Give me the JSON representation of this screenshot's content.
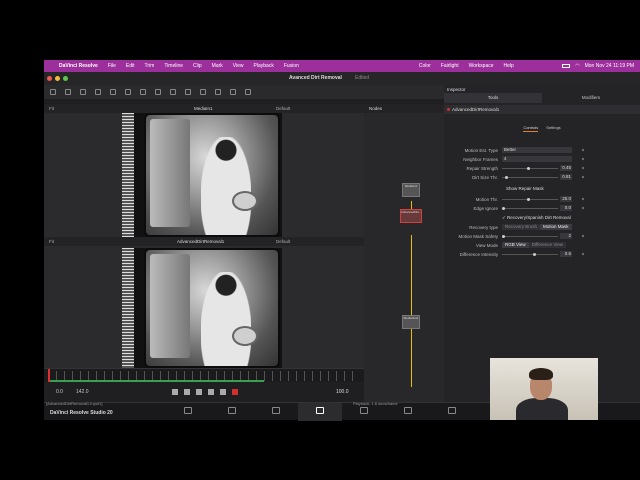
{
  "menubar": {
    "app_name": "DaVinci Resolve",
    "items": [
      "File",
      "Edit",
      "Trim",
      "Timeline",
      "Clip",
      "Mark",
      "View",
      "Playback",
      "Fusion",
      "Color",
      "Fairlight",
      "Workspace",
      "Help"
    ],
    "clock": "Mon Nov 24  11:19 PM"
  },
  "window": {
    "title": "Avanced Dirt Removal",
    "status": "Edited"
  },
  "viewer_top": {
    "fit": "Fit",
    "name": "MediaIn1",
    "default": "Default"
  },
  "viewer_bottom": {
    "fit": "Fit",
    "name": "AdvancedDirtRemoval1",
    "default": "Default"
  },
  "transport": {
    "start": "0.0",
    "end": "142.0",
    "current": "100.0"
  },
  "status_bar": {
    "left": "[AdvancedDirtRemoval1.Input1]",
    "right": "Playback: 1.6 secs/frame"
  },
  "nodes": {
    "title": "Nodes",
    "items": [
      "MediaIn1",
      "AdvancedDirt...",
      "MediaOut1"
    ]
  },
  "inspector": {
    "title": "Inspector",
    "tabs": [
      "Tools",
      "Modifiers"
    ],
    "node_name": "AdvancedDirtRemoval1",
    "subtabs": [
      "Controls",
      "Settings"
    ],
    "motion_est_type": {
      "label": "Motion Est. Type",
      "value": "Better"
    },
    "neighbor_frames": {
      "label": "Neighbor Frames",
      "value": "4"
    },
    "repair_strength": {
      "label": "Repair Strength",
      "value": "0.45",
      "fraction": 0.45
    },
    "dirt_size_thr": {
      "label": "Dirt Size Thr.",
      "value": "0.81",
      "fraction": 0.05
    },
    "show_repair_mask": {
      "label": "Show Repair Mask"
    },
    "motion_thr": {
      "label": "Motion Thr.",
      "value": "25.0",
      "fraction": 0.45
    },
    "edge_ignore": {
      "label": "Edge Ignore",
      "value": "0.0",
      "fraction": 0.0
    },
    "recovery_check": {
      "label": "Recovery/Spanish Dirt Removal"
    },
    "recovery_type": {
      "label": "Recovery type",
      "options": [
        "Recovery Brush",
        "Motion Mask"
      ],
      "selected": "Motion Mask"
    },
    "motion_mask_safety": {
      "label": "Motion Mask Safety",
      "value": "2",
      "fraction": 0.0
    },
    "view_mode": {
      "label": "View Mode",
      "options": [
        "RGB View",
        "Difference View"
      ],
      "selected": "RGB View"
    },
    "difference_intensity": {
      "label": "Difference Intensity",
      "value": "0.6",
      "fraction": 0.55
    }
  },
  "pagebar": {
    "brand": "DaVinci Resolve Studio 20"
  }
}
